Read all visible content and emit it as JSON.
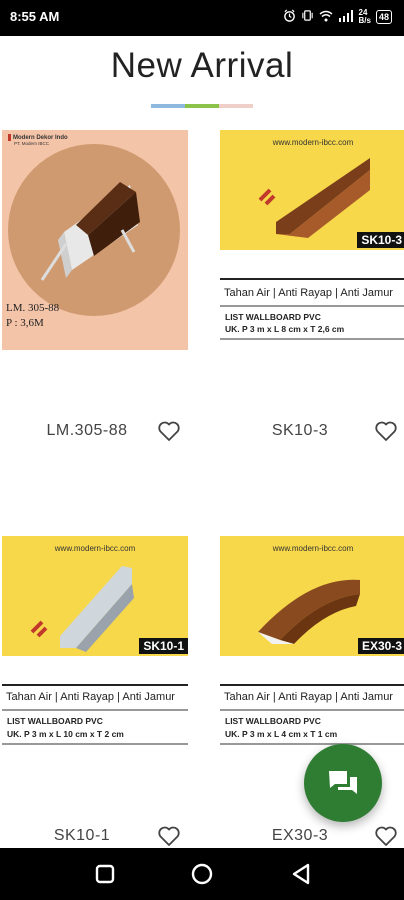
{
  "status_bar": {
    "time": "8:55 AM",
    "alarm_icon": "alarm-icon",
    "vibrate_icon": "vibrate-icon",
    "wifi_icon": "wifi-icon",
    "signal_icon": "signal-icon",
    "data_rate_top": "24",
    "data_rate_bottom": "B/s",
    "battery_level": "48"
  },
  "header": {
    "title": "New Arrival",
    "underline_colors": [
      "#8fb8de",
      "#8bc34a",
      "#f0cfc8"
    ]
  },
  "products": [
    {
      "name": "LM.305-88",
      "image": {
        "brand": "Modern Dekor Indo",
        "brand_sub": "PT. Modern IBCC",
        "code_line": "LM. 305-88",
        "length_line": "P : 3,6M"
      }
    },
    {
      "name": "SK10-3",
      "image": {
        "url": "www.modern-ibcc.com",
        "code": "SK10-3",
        "features": "Tahan Air | Anti Rayap | Anti Jamur",
        "spec_title": "LIST WALLBOARD PVC",
        "spec_size": "UK. P 3 m x L 8 cm x T 2,6 cm"
      }
    },
    {
      "name": "SK10-1",
      "image": {
        "url": "www.modern-ibcc.com",
        "code": "SK10-1",
        "features": "Tahan Air | Anti Rayap | Anti Jamur",
        "spec_title": "LIST WALLBOARD PVC",
        "spec_size": "UK. P 3 m x L 10 cm x T 2 cm"
      }
    },
    {
      "name": "EX30-3",
      "image": {
        "url": "www.modern-ibcc.com",
        "code": "EX30-3",
        "features": "Tahan Air | Anti Rayap | Anti Jamur",
        "spec_title": "LIST WALLBOARD PVC",
        "spec_size": "UK. P 3 m x L 4 cm x T 1 cm"
      }
    }
  ],
  "icons": {
    "favorite": "heart-outline-icon",
    "chat": "chat-icon",
    "nav_recents": "square-icon",
    "nav_home": "circle-icon",
    "nav_back": "triangle-back-icon"
  },
  "colors": {
    "fab": "#2e7d32",
    "yellow_bg": "#f7d84a",
    "peach_bg": "#f4c4a9"
  }
}
